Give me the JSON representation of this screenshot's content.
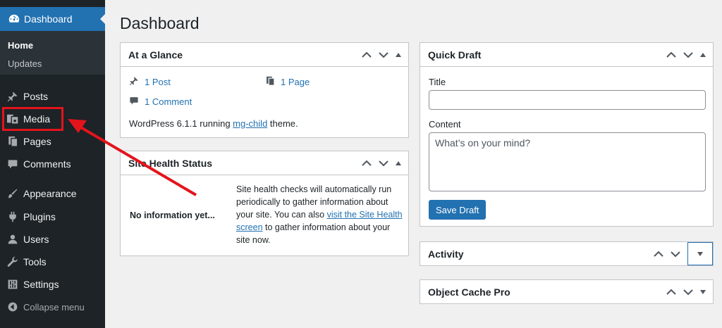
{
  "sidebar": {
    "dashboard_label": "Dashboard",
    "submenu": [
      {
        "label": "Home"
      },
      {
        "label": "Updates"
      }
    ],
    "items": [
      {
        "label": "Posts",
        "icon": "pin-icon"
      },
      {
        "label": "Media",
        "icon": "media-icon"
      },
      {
        "label": "Pages",
        "icon": "pages-icon"
      },
      {
        "label": "Comments",
        "icon": "comment-icon"
      },
      {
        "label": "Appearance",
        "icon": "brush-icon"
      },
      {
        "label": "Plugins",
        "icon": "plugin-icon"
      },
      {
        "label": "Users",
        "icon": "user-icon"
      },
      {
        "label": "Tools",
        "icon": "wrench-icon"
      },
      {
        "label": "Settings",
        "icon": "settings-icon"
      }
    ],
    "collapse_label": "Collapse menu"
  },
  "page": {
    "title": "Dashboard"
  },
  "at_a_glance": {
    "title": "At a Glance",
    "posts": "1 Post",
    "pages": "1 Page",
    "comments": "1 Comment",
    "version_prefix": "WordPress 6.1.1 running ",
    "theme_link": "mg-child",
    "version_suffix": " theme."
  },
  "site_health": {
    "title": "Site Health Status",
    "no_info": "No information yet...",
    "desc_1": "Site health checks will automatically run periodically to gather information about your site. You can also ",
    "link": "visit the Site Health screen",
    "desc_2": " to gather information about your site now."
  },
  "quick_draft": {
    "title": "Quick Draft",
    "title_label": "Title",
    "title_value": "",
    "content_label": "Content",
    "content_placeholder": "What’s on your mind?",
    "save_label": "Save Draft"
  },
  "activity": {
    "title": "Activity"
  },
  "object_cache": {
    "title": "Object Cache Pro"
  },
  "colors": {
    "sidebar_bg": "#1d2327",
    "accent": "#2271b1",
    "annotation": "#e3141c"
  }
}
